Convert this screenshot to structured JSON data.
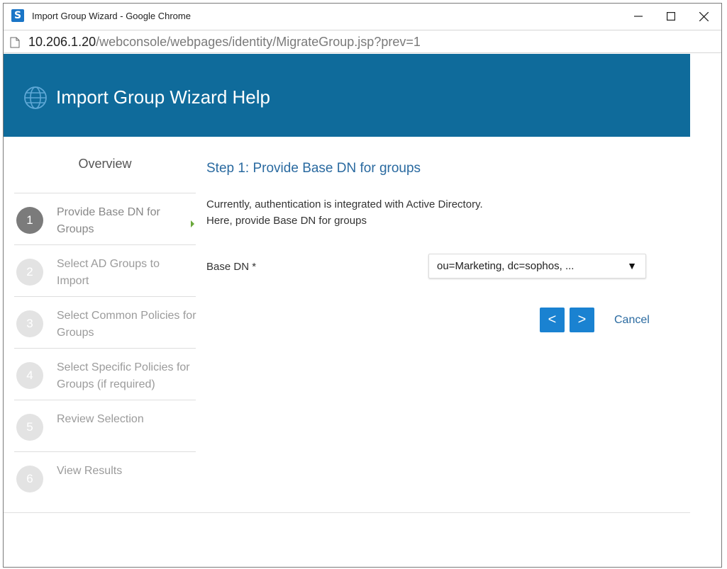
{
  "browser": {
    "favicon_letter": "S",
    "window_title": "Import Group Wizard - Google Chrome",
    "url_host": "10.206.1.20",
    "url_path": "/webconsole/webpages/identity/MigrateGroup.jsp?prev=1"
  },
  "header": {
    "title": "Import Group Wizard Help",
    "icon": "globe-icon"
  },
  "sidebar": {
    "overview_label": "Overview",
    "steps": [
      {
        "number": "1",
        "label": "Provide Base DN for Groups",
        "active": true
      },
      {
        "number": "2",
        "label": "Select AD Groups to Import",
        "active": false
      },
      {
        "number": "3",
        "label": "Select Common Policies for Groups",
        "active": false
      },
      {
        "number": "4",
        "label": "Select Specific Policies for Groups (if required)",
        "active": false
      },
      {
        "number": "5",
        "label": "Review Selection",
        "active": false
      },
      {
        "number": "6",
        "label": "View Results",
        "active": false
      }
    ]
  },
  "main": {
    "step_title": "Step 1: Provide Base DN for groups",
    "description_line1": "Currently, authentication is integrated with Active Directory.",
    "description_line2": "Here, provide Base DN for groups",
    "base_dn_label": "Base DN *",
    "base_dn_value": "ou=Marketing, dc=sophos, ...",
    "prev_label": "<",
    "next_label": ">",
    "cancel_label": "Cancel"
  },
  "colors": {
    "header_bg": "#0f6b9b",
    "accent_blue": "#1a82d1",
    "link_blue": "#2a6aa0",
    "active_step": "#7b7b7b",
    "inactive_step": "#e3e3e3",
    "active_arrow": "#6aa83b"
  }
}
